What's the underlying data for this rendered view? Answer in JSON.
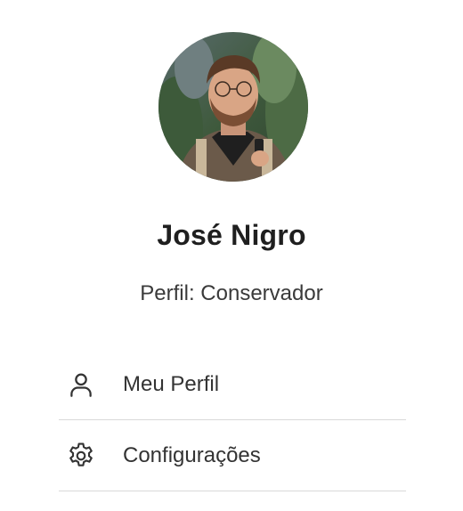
{
  "user": {
    "name": "José Nigro",
    "profile": "Perfil: Conservador"
  },
  "menu": {
    "items": [
      {
        "label": "Meu Perfil",
        "icon": "user-icon"
      },
      {
        "label": "Configurações",
        "icon": "gear-icon"
      }
    ]
  },
  "colors": {
    "text_primary": "#1f1f1f",
    "text_secondary": "#3a3a3a",
    "divider": "#d9d9d9",
    "background": "#ffffff"
  }
}
